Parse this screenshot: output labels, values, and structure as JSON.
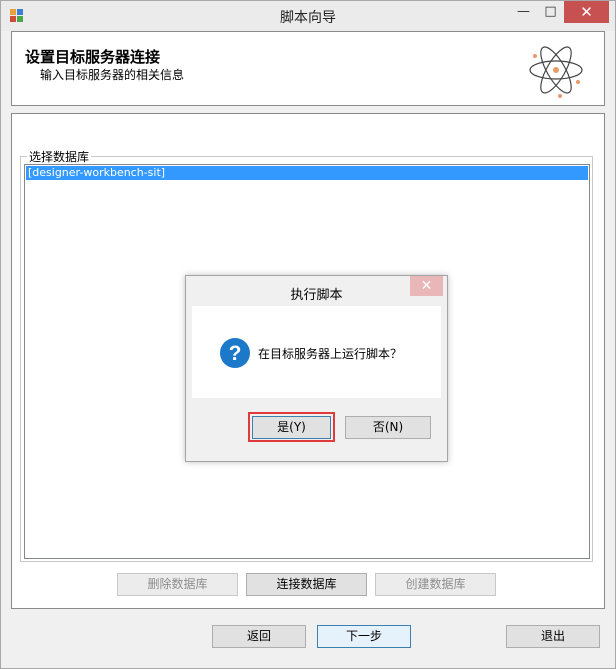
{
  "window": {
    "title": "脚本向导",
    "minimize_glyph": "—",
    "maximize_glyph": "□",
    "close_glyph": "✕"
  },
  "header": {
    "title": "设置目标服务器连接",
    "subtitle": "输入目标服务器的相关信息"
  },
  "database_group": {
    "label": "选择数据库",
    "items": [
      "[designer-workbench-sit]"
    ],
    "selected_index": 0
  },
  "db_buttons": {
    "delete": "删除数据库",
    "connect": "连接数据库",
    "create": "创建数据库"
  },
  "nav_buttons": {
    "back": "返回",
    "next": "下一步",
    "exit": "退出"
  },
  "dialog": {
    "title": "执行脚本",
    "close_glyph": "✕",
    "message": "在目标服务器上运行脚本？",
    "yes_label": "是(Y)",
    "no_label": "否(N)"
  },
  "colors": {
    "selection": "#3399ff",
    "question_icon": "#1c78c8",
    "highlight_box": "#e03a3a"
  }
}
